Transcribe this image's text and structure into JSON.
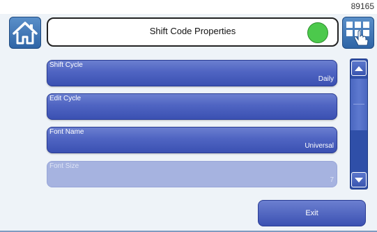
{
  "header": {
    "device_id": "89165",
    "title": "Shift Code Properties",
    "status_color": "#4cc94c"
  },
  "icons": {
    "home": "home-icon",
    "menu": "grid-menu-hand-icon",
    "scroll_up": "triangle-up-icon",
    "scroll_down": "triangle-down-icon"
  },
  "fields": [
    {
      "label": "Shift Cycle",
      "value": "Daily",
      "enabled": true
    },
    {
      "label": "Edit Cycle",
      "value": "",
      "enabled": true
    },
    {
      "label": "Font Name",
      "value": "Universal",
      "enabled": true
    },
    {
      "label": "Font Size",
      "value": "7",
      "enabled": false
    }
  ],
  "footer": {
    "exit_label": "Exit"
  },
  "colors": {
    "field_blue": "#4f64c2",
    "field_disabled": "#a6b3e0",
    "button_blue": "#2f65a6",
    "background": "#eef3f8"
  }
}
